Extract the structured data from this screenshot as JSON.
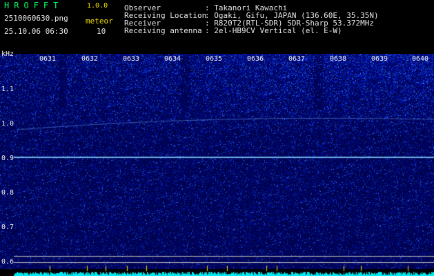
{
  "header": {
    "app_name": "HROFFT",
    "version": "1.0.0",
    "filename": "2510060630.png",
    "datetime": "25.10.06 06:30",
    "counter_label": "meteor",
    "counter_value": "10"
  },
  "station": {
    "rows": [
      {
        "label": "Observer",
        "value": ": Takanori Kawachi"
      },
      {
        "label": "Receiving Location",
        "value": ": Ogaki, Gifu, JAPAN (136.60E, 35.35N)"
      },
      {
        "label": "Receiver",
        "value": ": R820T2(RTL-SDR) SDR-Sharp 53.372MHz"
      },
      {
        "label": "Receiving antenna",
        "value": ": 2el-HB9CV Vertical (el. E-W)"
      }
    ]
  },
  "spectrogram": {
    "y_unit": "kHz",
    "y_ticks": [
      "1.1",
      "1.0",
      "0.9",
      "0.8",
      "0.7",
      "0.6"
    ],
    "x_ticks": [
      "0631",
      "0632",
      "0633",
      "0634",
      "0635",
      "0636",
      "0637",
      "0638",
      "0639",
      "0640"
    ],
    "colors": {
      "background": "#000058",
      "noise": "#1a2fd0",
      "signal": "#7fdfff",
      "floor": "#00ffff"
    }
  }
}
